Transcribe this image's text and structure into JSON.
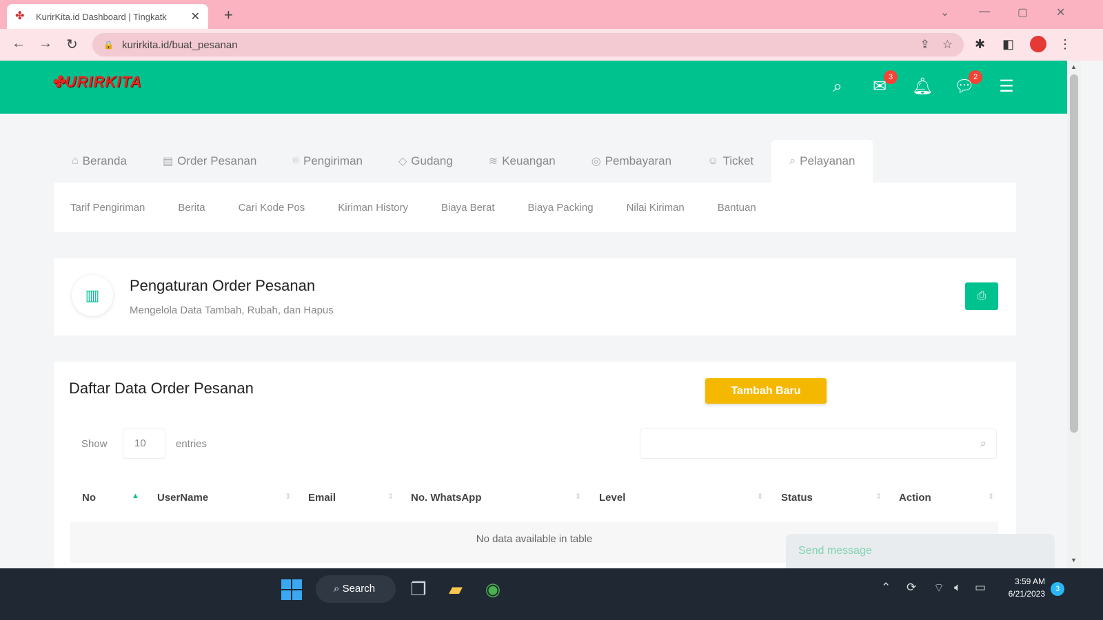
{
  "browser": {
    "tab_title": "KurirKita.id Dashboard | Tingkatk",
    "url": "kurirkita.id/buat_pesanan"
  },
  "site": {
    "logo_text": "URIRKITA",
    "header_badges": {
      "mail": "3",
      "chat": "2"
    },
    "nav": [
      {
        "label": "Beranda",
        "icon": "home-icon"
      },
      {
        "label": "Order Pesanan",
        "icon": "order-icon"
      },
      {
        "label": "Pengiriman",
        "icon": "location-icon"
      },
      {
        "label": "Gudang",
        "icon": "warehouse-icon"
      },
      {
        "label": "Keuangan",
        "icon": "money-icon"
      },
      {
        "label": "Pembayaran",
        "icon": "payment-icon"
      },
      {
        "label": "Ticket",
        "icon": "ticket-icon"
      },
      {
        "label": "Pelayanan",
        "icon": "search-icon"
      }
    ],
    "subnav": [
      "Tarif Pengiriman",
      "Berita",
      "Cari Kode Pos",
      "Kiriman History",
      "Biaya Berat",
      "Biaya Packing",
      "Nilai Kiriman",
      "Bantuan"
    ]
  },
  "page": {
    "title": "Pengaturan Order Pesanan",
    "subtitle": "Mengelola Data Tambah, Rubah, dan Hapus"
  },
  "table": {
    "title": "Daftar Data Order Pesanan",
    "add_label": "Tambah Baru",
    "show_label": "Show",
    "show_value": "10",
    "entries_label": "entries",
    "columns": [
      "No",
      "UserName",
      "Email",
      "No. WhatsApp",
      "Level",
      "Status",
      "Action"
    ],
    "empty_text": "No data available in table"
  },
  "chat": {
    "placeholder": "Send message"
  },
  "taskbar": {
    "search_label": "Search",
    "time": "3:59 AM",
    "date": "6/21/2023",
    "notification_count": "3"
  }
}
